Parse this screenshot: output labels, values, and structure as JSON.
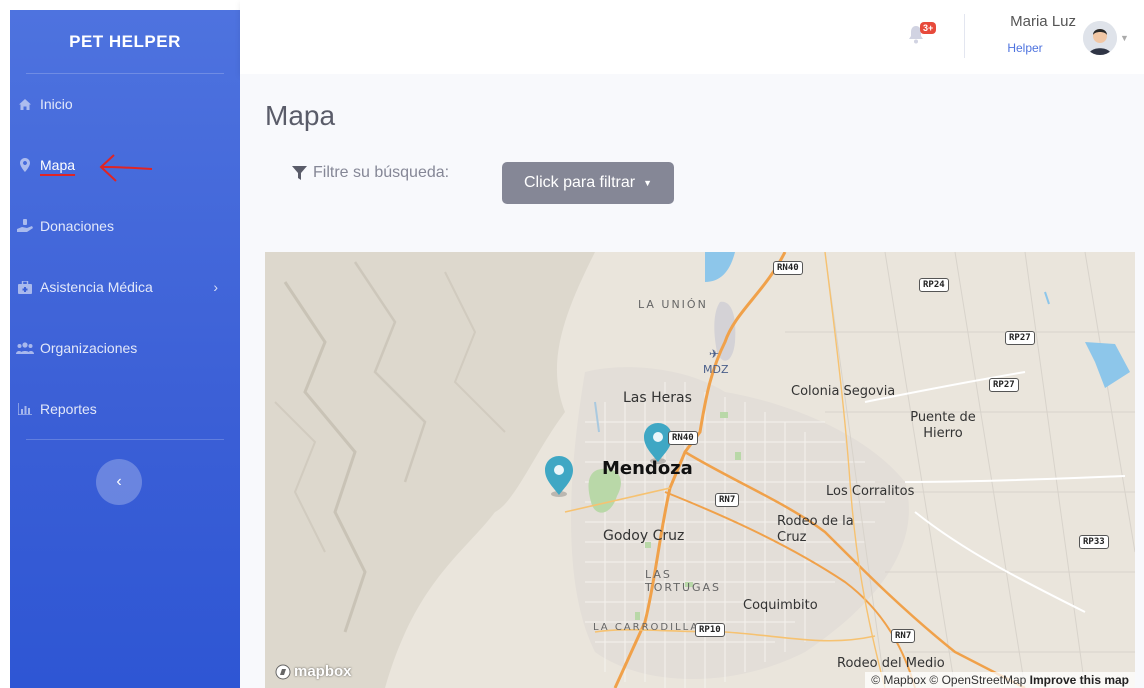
{
  "sidebar": {
    "brand": "PET HELPER",
    "items": [
      {
        "label": "Inicio",
        "icon": "home-icon"
      },
      {
        "label": "Mapa",
        "icon": "map-marker-icon",
        "active": true
      },
      {
        "label": "Donaciones",
        "icon": "hand-holding-icon"
      },
      {
        "label": "Asistencia Médica",
        "icon": "briefcase-medical-icon",
        "has_submenu": true
      },
      {
        "label": "Organizaciones",
        "icon": "users-icon"
      },
      {
        "label": "Reportes",
        "icon": "chart-area-icon"
      }
    ],
    "collapse_icon": "‹"
  },
  "topbar": {
    "notification_badge": "3+",
    "user_name": "Maria Luz",
    "user_role": "Helper"
  },
  "main": {
    "title": "Mapa",
    "filter_label": "Filtre su búsqueda:",
    "filter_button": "Click para filtrar"
  },
  "map": {
    "places": [
      "LA UNIÓN",
      "Las Heras",
      "Colonia Segovia",
      "Puente de Hierro",
      "Mendoza",
      "Los Corralitos",
      "Rodeo de la Cruz",
      "Godoy Cruz",
      "LAS TORTUGAS",
      "Coquimbito",
      "LA CARRODILLA",
      "Rodeo del Medio",
      "MDZ"
    ],
    "routes": [
      "RN40",
      "RP24",
      "RP27",
      "RP27",
      "RN40",
      "RN7",
      "RP33",
      "RP10",
      "RN7"
    ],
    "attribution": "© Mapbox © OpenStreetMap",
    "improve": "Improve this map",
    "logo": "mapbox",
    "marker_color": "#3fa7c4"
  },
  "colors": {
    "sidebar": "#4e73df",
    "annotation_red": "#e02424"
  }
}
